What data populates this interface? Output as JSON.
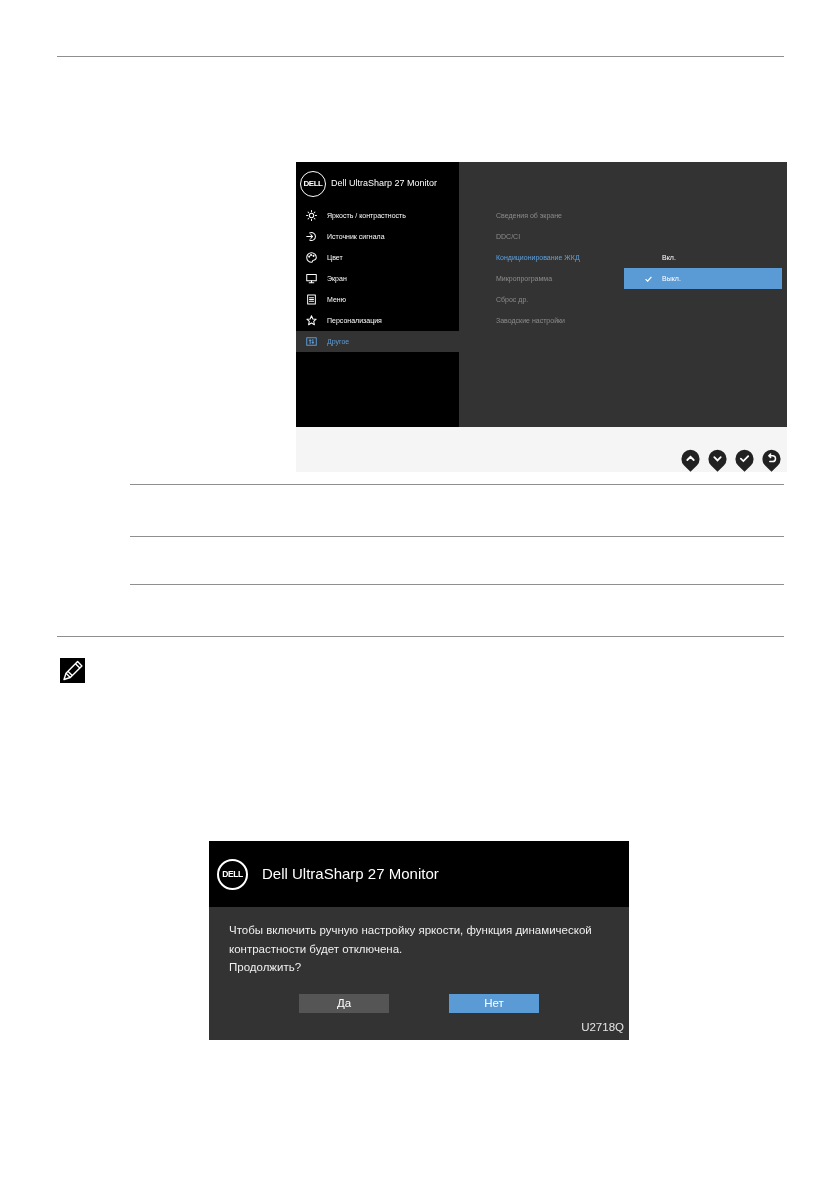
{
  "osd": {
    "logo": "DELL",
    "title": "Dell UltraSharp 27 Monitor",
    "menu": [
      {
        "label": "Яркость / контрастность",
        "selected": false
      },
      {
        "label": "Источник сигнала",
        "selected": false
      },
      {
        "label": "Цвет",
        "selected": false
      },
      {
        "label": "Экран",
        "selected": false
      },
      {
        "label": "Меню",
        "selected": false
      },
      {
        "label": "Персонализация",
        "selected": false
      },
      {
        "label": "Другое",
        "selected": true
      }
    ],
    "submenu": [
      {
        "label": "Сведения об экране",
        "selected": false
      },
      {
        "label": "DDC/CI",
        "selected": false
      },
      {
        "label": "Кондиционирование ЖКД",
        "selected": true
      },
      {
        "label": "Микропрограмма",
        "selected": false
      },
      {
        "label": "Сброс др.",
        "selected": false
      },
      {
        "label": "Заводские настройки",
        "selected": false
      }
    ],
    "options": [
      {
        "label": "Вкл.",
        "selected": false
      },
      {
        "label": "Выкл.",
        "selected": true
      }
    ]
  },
  "dialog": {
    "logo": "DELL",
    "title": "Dell UltraSharp 27 Monitor",
    "message": "Чтобы включить ручную настройку яркости, функция динамической контрастности будет отключена.",
    "question": "Продолжить?",
    "buttons": [
      {
        "label": "Да",
        "selected": false
      },
      {
        "label": "Нет",
        "selected": true
      }
    ],
    "model": "U2718Q"
  }
}
